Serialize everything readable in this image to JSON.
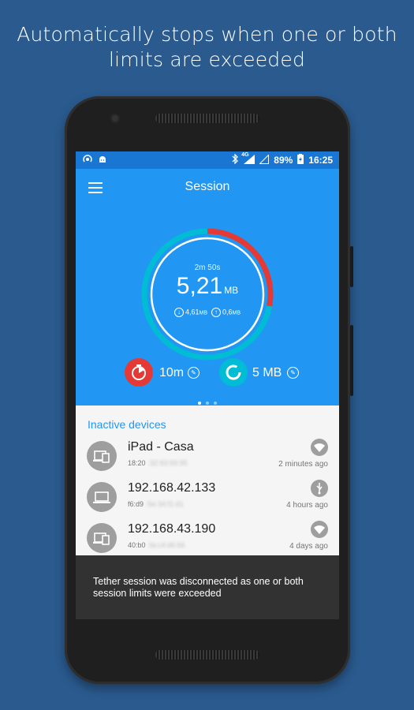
{
  "headline": {
    "line1": "Automatically stops when one or both",
    "line2": "limits are exceeded"
  },
  "statusbar": {
    "left_icons": [
      "hotspot-icon",
      "android-icon"
    ],
    "right_icons": [
      "bluetooth-icon",
      "signal-4g-icon",
      "signal-empty-icon",
      "battery-charging-icon"
    ],
    "network": "4G",
    "battery": "89%",
    "time": "16:25"
  },
  "appbar": {
    "title": "Session",
    "menu_icon": "hamburger-icon"
  },
  "gauge": {
    "elapsed": "2m 50s",
    "value": "5,21",
    "unit": "MB",
    "download": "4,61",
    "download_unit": "MB",
    "upload": "0,6",
    "upload_unit": "MB",
    "progress_fraction": 0.28,
    "colors": {
      "track": "#00bcd4",
      "progress": "#e53935",
      "ring": "#ffffff"
    }
  },
  "limits": {
    "time": {
      "value": "10m",
      "icon": "timer-icon",
      "color": "#e53935"
    },
    "data": {
      "value": "5 MB",
      "icon": "data-gauge-icon",
      "color": "#00bcd4"
    }
  },
  "pager": {
    "count": 3,
    "active": 0
  },
  "inactive_devices": {
    "title": "Inactive devices",
    "items": [
      {
        "name": "iPad - Casa",
        "mac_prefix": "18:20",
        "mac_hidden": ":32:93:59:95",
        "icon": "devices-icon",
        "badge": "wifi-icon",
        "ago": "2 minutes ago"
      },
      {
        "name": "192.168.42.133",
        "mac_prefix": "f6:d9",
        "mac_hidden": ":5e:34:f1:d1",
        "icon": "laptop-icon",
        "badge": "usb-icon",
        "ago": "4 hours ago"
      },
      {
        "name": "192.168.43.190",
        "mac_prefix": "40:b0",
        "mac_hidden": ":fa:c4:d6:66",
        "icon": "devices-icon",
        "badge": "wifi-icon",
        "ago": "4 days ago"
      }
    ]
  },
  "snackbar": {
    "message": "Tether session was disconnected as one or both session limits were exceeded"
  },
  "colors": {
    "background": "#2a5a8e",
    "primary": "#2196f3",
    "primary_dark": "#1976d2",
    "accent_red": "#e53935",
    "accent_teal": "#00bcd4"
  }
}
